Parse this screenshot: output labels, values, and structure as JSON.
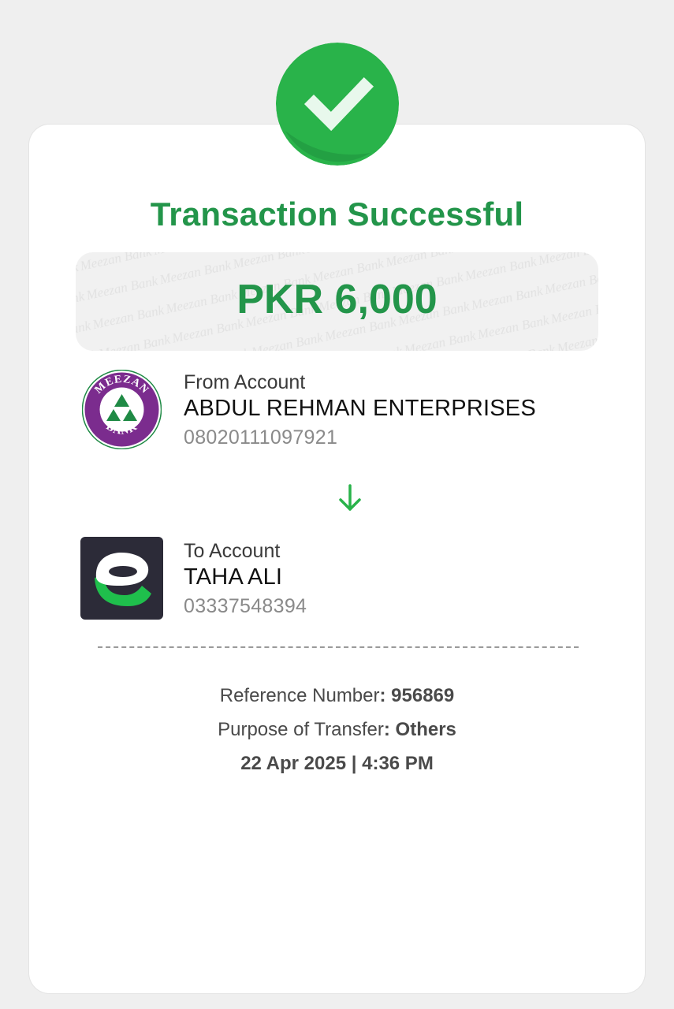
{
  "status": {
    "title": "Transaction Successful",
    "icon": "checkmark-icon",
    "accent_color": "#23954a"
  },
  "amount": {
    "text": "PKR 6,000",
    "watermark_text": "Meezan Bank"
  },
  "from_account": {
    "label": "From Account",
    "name": "ABDUL REHMAN ENTERPRISES",
    "number": "08020111097921",
    "logo": "meezan-bank-logo",
    "logo_text_top": "MEEZAN",
    "logo_text_bottom": "BANK"
  },
  "to_account": {
    "label": "To Account",
    "name": "TAHA ALI",
    "number": "03337548394",
    "logo": "wallet-app-logo"
  },
  "details": {
    "reference_label": "Reference Number",
    "reference_value": ": 956869",
    "purpose_label": "Purpose of Transfer",
    "purpose_value": ": Others",
    "datetime": "22 Apr 2025 | 4:36 PM"
  }
}
